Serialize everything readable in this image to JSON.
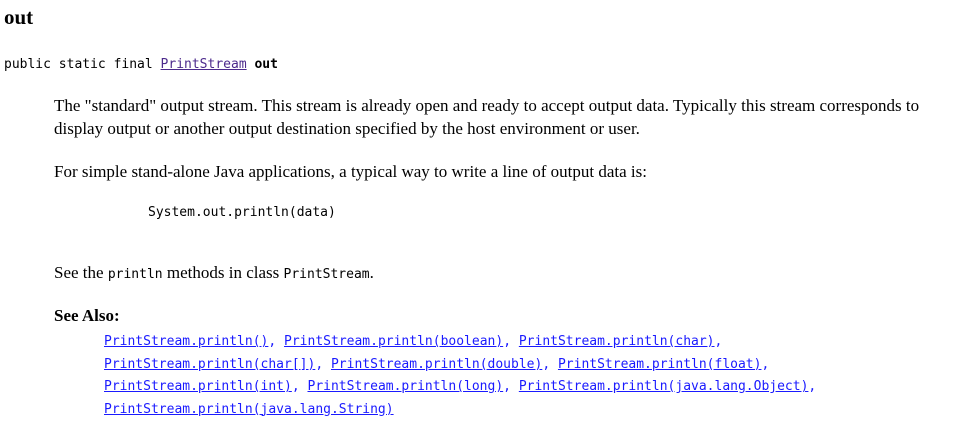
{
  "field": {
    "name": "out",
    "signature": {
      "modifiers": "public static final ",
      "type_link": "PrintStream",
      "name": "out"
    }
  },
  "description": {
    "p1": "The \"standard\" output stream. This stream is already open and ready to accept output data. Typically this stream corresponds to display output or another output destination specified by the host environment or user.",
    "p2": "For simple stand-alone Java applications, a typical way to write a line of output data is:",
    "code": "System.out.println(data)",
    "p3_prefix": "See the ",
    "p3_code1": "println",
    "p3_middle": " methods in class ",
    "p3_code2": "PrintStream",
    "p3_suffix": "."
  },
  "see_also": {
    "label": "See Also:",
    "links": [
      "PrintStream.println()",
      "PrintStream.println(boolean)",
      "PrintStream.println(char)",
      "PrintStream.println(char[])",
      "PrintStream.println(double)",
      "PrintStream.println(float)",
      "PrintStream.println(int)",
      "PrintStream.println(long)",
      "PrintStream.println(java.lang.Object)",
      "PrintStream.println(java.lang.String)"
    ],
    "separator": ", "
  },
  "colors": {
    "visited_link": "#4c2a8c",
    "link": "#1a1aff",
    "text": "#000000"
  }
}
